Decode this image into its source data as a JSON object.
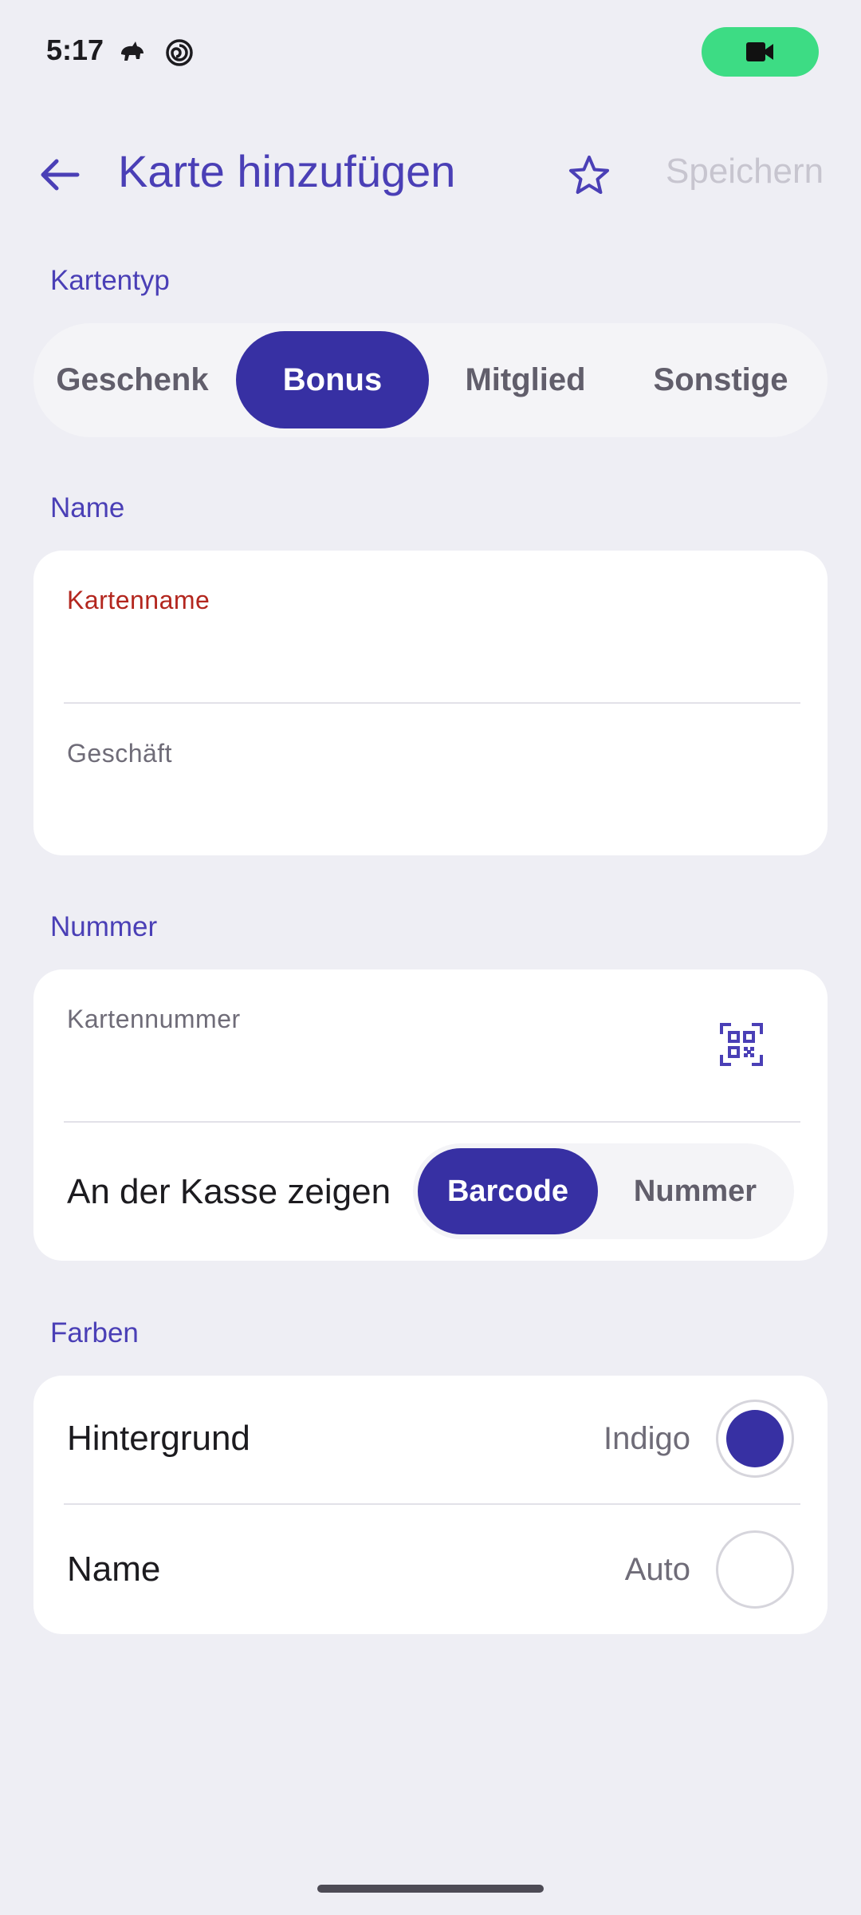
{
  "status_bar": {
    "time": "5:17",
    "icons": [
      "cat-notification-icon",
      "spiral-notification-icon"
    ],
    "camera_indicator_color": "#3ddc84",
    "camera_icon": "video-camera-icon"
  },
  "app_bar": {
    "back_icon": "arrow-back-icon",
    "title": "Karte hinzufügen",
    "favorite_icon": "star-outline-icon",
    "save_label": "Speichern"
  },
  "colors": {
    "accent": "#4a3fb6",
    "primary": "#3730a3",
    "error": "#b3261e",
    "background": "#eeeef4"
  },
  "card_type": {
    "section_label": "Kartentyp",
    "options": [
      "Geschenk",
      "Bonus",
      "Mitglied",
      "Sonstige"
    ],
    "selected": "Bonus"
  },
  "name_section": {
    "section_label": "Name",
    "card_name_label": "Kartenname",
    "card_name_value": "",
    "store_label": "Geschäft",
    "store_value": ""
  },
  "number_section": {
    "section_label": "Nummer",
    "card_number_label": "Kartennummer",
    "card_number_value": "",
    "scan_icon": "qr-code-scan-icon",
    "show_at_checkout_label": "An der Kasse zeigen",
    "show_options": [
      "Barcode",
      "Nummer"
    ],
    "show_selected": "Barcode"
  },
  "colors_section": {
    "section_label": "Farben",
    "background_label": "Hintergrund",
    "background_value": "Indigo",
    "background_swatch": "#3730a3",
    "name_label": "Name",
    "name_value": "Auto",
    "name_swatch": "#ffffff"
  }
}
